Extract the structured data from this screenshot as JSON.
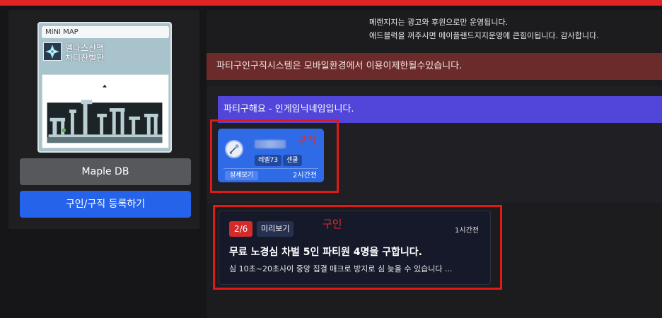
{
  "minimap": {
    "label": "MINI MAP",
    "map_name_line1": "엘나스산맥",
    "map_name_line2": "차디찬벌판"
  },
  "sidebar": {
    "db_button": "Maple DB",
    "register_button": "구인/구직 등록하기"
  },
  "notice": {
    "line1": "메랜지지는 광고와 후원으로만 운영됩니다.",
    "line2": "애드블럭을 꺼주시면 메이플랜드지지운영에 큰힘이됩니다. 감사합니다."
  },
  "alert": "파티구인구직시스템은 모바일환경에서 이용이제한될수있습니다.",
  "party_header": "파티구해요 - 인게임닉네임입니다.",
  "seeker_card": {
    "level_tag": "레벨73",
    "location_tag": "센쿨",
    "detail_button": "상세보기",
    "time": "2시간전"
  },
  "recruit_card": {
    "count": "2/6",
    "preview_button": "미리보기",
    "time": "1시간전",
    "title": "무료 노경심 차벌 5인 파티원 4명을 구합니다.",
    "description": "심 10초~20초사이 중앙 집결 매크로 방지로 심 늦을 수 있습니다 ..."
  },
  "annotations": {
    "seeker": "구직",
    "recruiter": "구인"
  },
  "colors": {
    "accent_blue": "#2563eb",
    "alert_red": "#6b2b2b",
    "party_purple": "#5146d9",
    "annotation_red": "#e01a1a"
  }
}
